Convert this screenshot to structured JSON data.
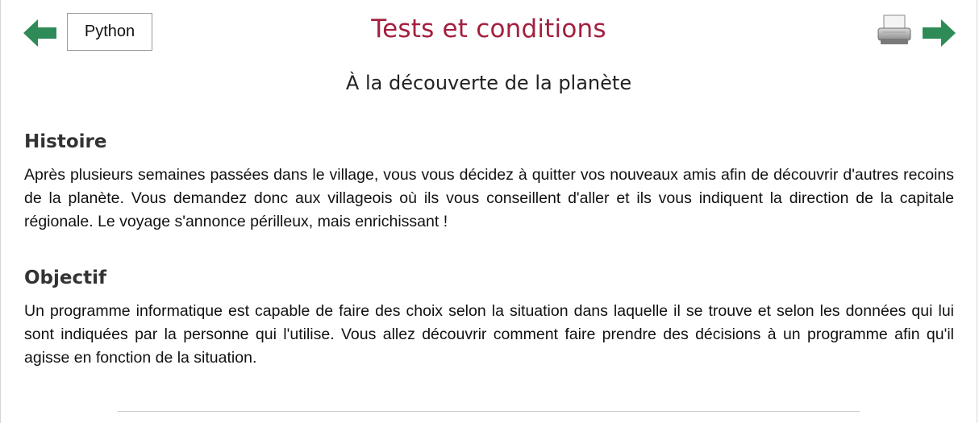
{
  "header": {
    "title": "Tests et conditions",
    "language_button": "Python",
    "prev_icon": "arrow-left-icon",
    "next_icon": "arrow-right-icon",
    "print_icon": "printer-icon"
  },
  "subtitle": "À la découverte de la planète",
  "sections": [
    {
      "heading": "Histoire",
      "text": "Après plusieurs semaines passées dans le village, vous vous décidez à quitter vos nouveaux amis afin de découvrir d'autres recoins de la planète. Vous demandez donc aux villageois où ils vous conseillent d'aller et ils vous indiquent la direction de la capitale régionale. Le voyage s'annonce périlleux, mais enrichissant !"
    },
    {
      "heading": "Objectif",
      "text": "Un programme informatique est capable de faire des choix selon la situation dans laquelle il se trouve et selon les données qui lui sont indiquées par la personne qui l'utilise. Vous allez découvrir comment faire prendre des décisions à un programme afin qu'il agisse en fonction de la situation."
    }
  ],
  "colors": {
    "title": "#a41f3e",
    "arrow": "#2e8b57",
    "text": "#111111"
  }
}
